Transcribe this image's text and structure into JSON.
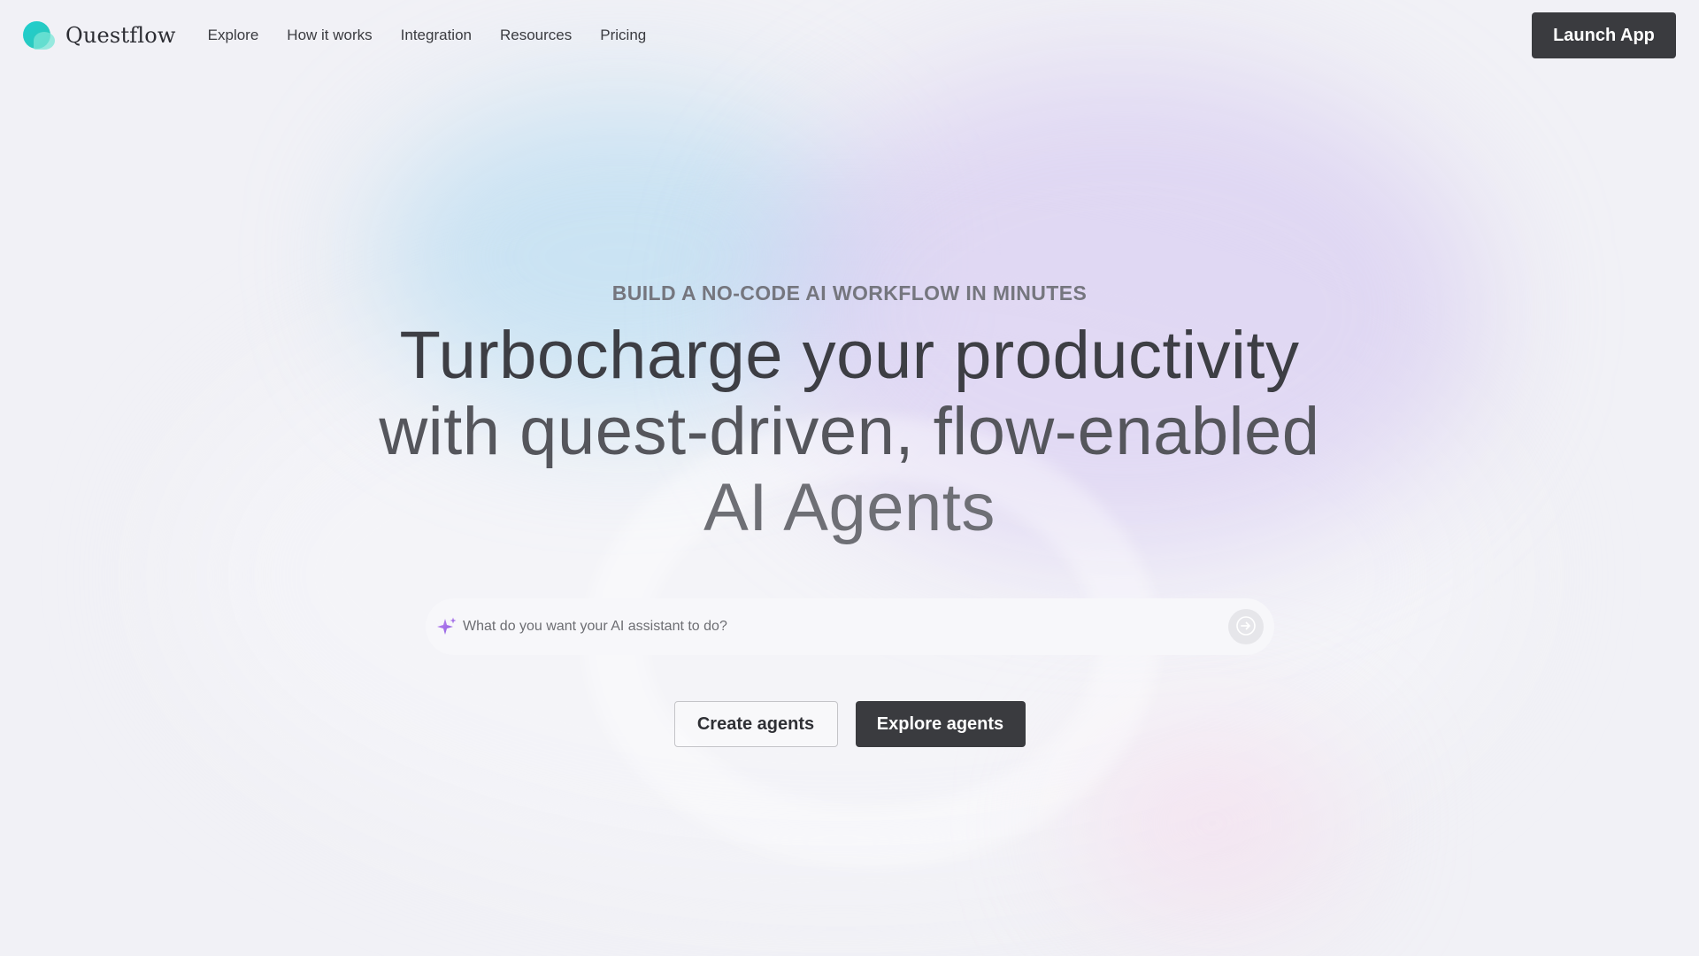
{
  "brand": {
    "name": "Questflow",
    "colors": {
      "logo": "#1fcfd0",
      "dark_button": "#3a3b3f",
      "sparkle": "#a974e8"
    }
  },
  "nav": {
    "items": [
      "Explore",
      "How it works",
      "Integration",
      "Resources",
      "Pricing"
    ]
  },
  "header": {
    "launch_label": "Launch App"
  },
  "hero": {
    "eyebrow": "BUILD A NO-CODE AI WORKFLOW IN MINUTES",
    "headline_line1": "Turbocharge your productivity",
    "headline_line2": "with quest-driven, flow-enabled",
    "headline_line3": "AI Agents"
  },
  "search": {
    "placeholder": "What do you want your AI assistant to do?",
    "value": "",
    "icon": "sparkle-icon",
    "send_icon": "arrow-right-icon"
  },
  "cta": {
    "create_label": "Create agents",
    "explore_label": "Explore agents"
  }
}
